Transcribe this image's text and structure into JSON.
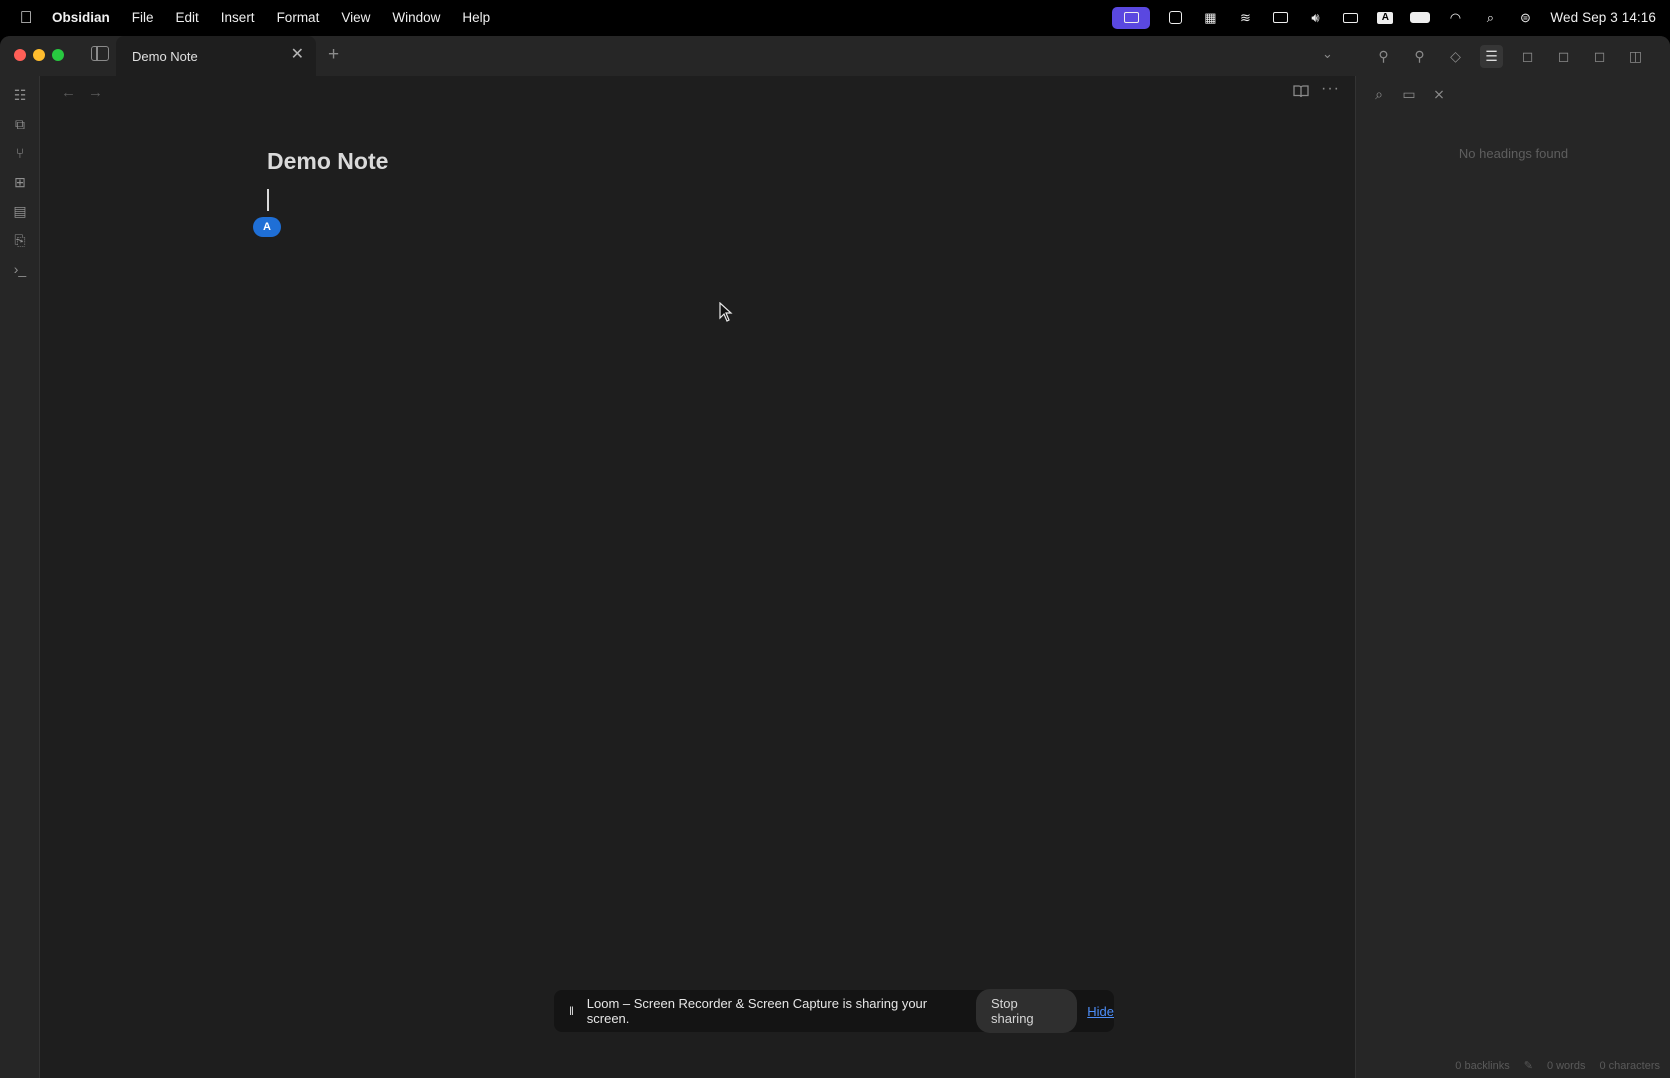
{
  "menubar": {
    "app_name": "Obsidian",
    "menus": [
      "File",
      "Edit",
      "Insert",
      "Format",
      "View",
      "Window",
      "Help"
    ],
    "clock": "Wed Sep 3  14:16",
    "accent_color": "#5a48e0"
  },
  "tab": {
    "title": "Demo Note",
    "close_glyph": "✕",
    "new_glyph": "+"
  },
  "note": {
    "title": "Demo Note",
    "collab_cursor_initial": "A",
    "collab_cursor_color": "#1f6fd6"
  },
  "outline": {
    "empty_message": "No headings found"
  },
  "status_bar": {
    "backlinks": "0 backlinks",
    "words": "0 words",
    "characters": "0 characters"
  },
  "loom": {
    "message": "Loom – Screen Recorder & Screen Capture is sharing your screen.",
    "stop_label": "Stop sharing",
    "hide_label": "Hide"
  }
}
